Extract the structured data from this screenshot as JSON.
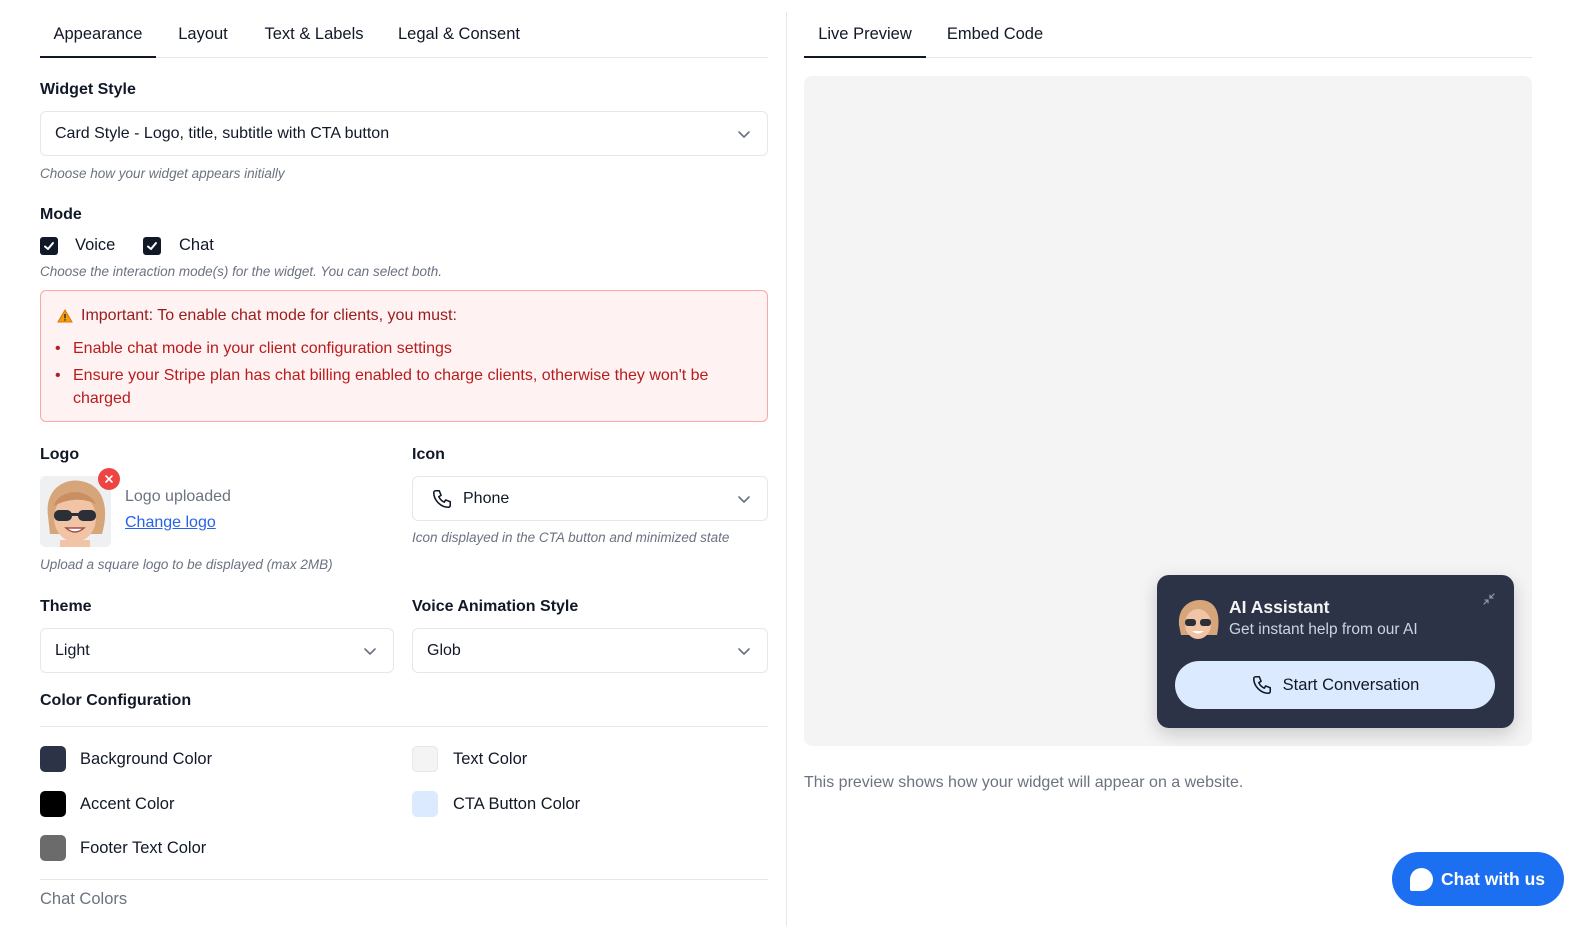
{
  "left_tabs": [
    "Appearance",
    "Layout",
    "Text & Labels",
    "Legal & Consent"
  ],
  "right_tabs": [
    "Live Preview",
    "Embed Code"
  ],
  "widget_style": {
    "label": "Widget Style",
    "value": "Card Style - Logo, title, subtitle with CTA button",
    "hint": "Choose how your widget appears initially"
  },
  "mode": {
    "label": "Mode",
    "options": [
      {
        "label": "Voice",
        "checked": true
      },
      {
        "label": "Chat",
        "checked": true
      }
    ],
    "hint": "Choose the interaction mode(s) for the widget. You can select both."
  },
  "alert": {
    "title": "Important: To enable chat mode for clients, you must:",
    "items": [
      "Enable chat mode in your client configuration settings",
      "Ensure your Stripe plan has chat billing enabled to charge clients, otherwise they won't be charged"
    ],
    "icon": "warning-icon"
  },
  "logo": {
    "label": "Logo",
    "status": "Logo uploaded",
    "link": "Change logo",
    "hint": "Upload a square logo to be displayed (max 2MB)"
  },
  "icon_field": {
    "label": "Icon",
    "value": "Phone",
    "icon": "phone-icon",
    "hint": "Icon displayed in the CTA button and minimized state"
  },
  "theme": {
    "label": "Theme",
    "value": "Light"
  },
  "voice_animation": {
    "label": "Voice Animation Style",
    "value": "Glob"
  },
  "color_config": {
    "label": "Color Configuration",
    "colors": [
      {
        "label": "Background Color",
        "color": "#2d3346"
      },
      {
        "label": "Text Color",
        "color": "#f4f4f5"
      },
      {
        "label": "Accent Color",
        "color": "#000000"
      },
      {
        "label": "CTA Button Color",
        "color": "#dbeafe"
      },
      {
        "label": "Footer Text Color",
        "color": "#6b6b6b"
      }
    ]
  },
  "chat_colors_label": "Chat Colors",
  "preview": {
    "widget_title": "AI Assistant",
    "widget_subtitle": "Get instant help from our AI",
    "cta": "Start Conversation",
    "note": "This preview shows how your widget will appear on a website."
  },
  "chat_fab": "Chat with us",
  "colors": {
    "accent": "#111827",
    "alert_bg": "#fef2f2",
    "alert_text": "#b91c1c",
    "link": "#2563eb",
    "fab": "#1d6ff2"
  }
}
